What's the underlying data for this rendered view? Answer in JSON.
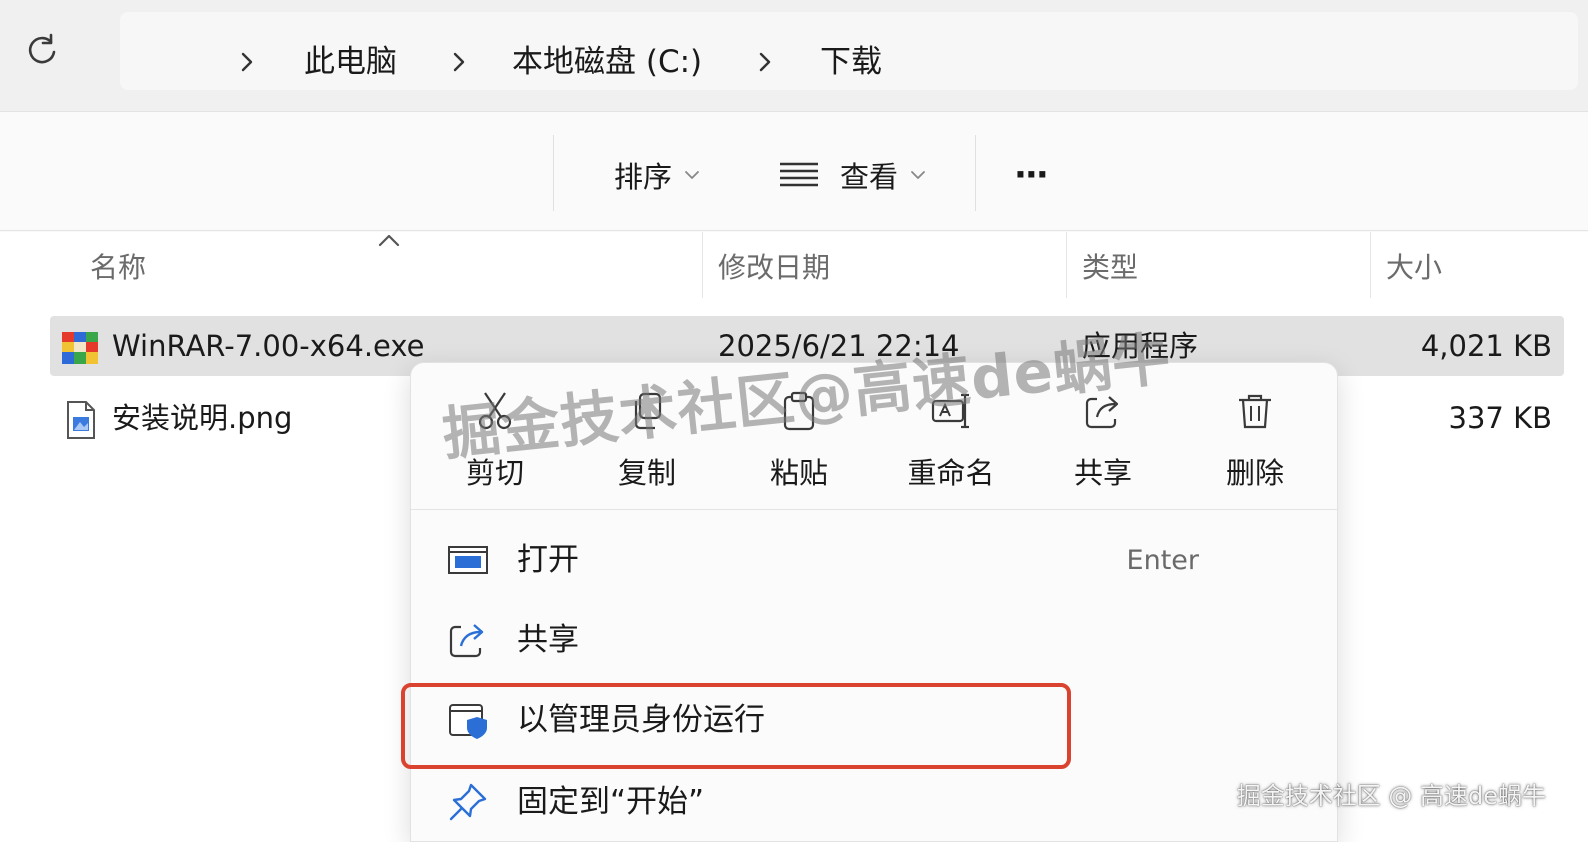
{
  "breadcrumb": {
    "items": [
      "此电脑",
      "本地磁盘 (C:)",
      "下载"
    ]
  },
  "toolbar": {
    "sort_label": "排序",
    "view_label": "查看",
    "more_label": "···"
  },
  "columns": {
    "name": "名称",
    "modified": "修改日期",
    "type": "类型",
    "size": "大小"
  },
  "files": [
    {
      "name": "WinRAR-7.00-x64.exe",
      "modified": "2025/6/21 22:14",
      "type": "应用程序",
      "size": "4,021 KB",
      "icon": "winrar-icon",
      "selected": true
    },
    {
      "name": "安装说明.png",
      "modified": "",
      "type": "",
      "size": "337 KB",
      "icon": "png-file-icon",
      "selected": false
    }
  ],
  "context_menu": {
    "quick_actions": [
      {
        "label": "剪切",
        "icon": "scissors-icon"
      },
      {
        "label": "复制",
        "icon": "copy-icon"
      },
      {
        "label": "粘贴",
        "icon": "paste-icon"
      },
      {
        "label": "重命名",
        "icon": "rename-icon"
      },
      {
        "label": "共享",
        "icon": "share-icon"
      },
      {
        "label": "删除",
        "icon": "trash-icon"
      }
    ],
    "items": [
      {
        "label": "打开",
        "shortcut": "Enter",
        "icon": "open-window-icon"
      },
      {
        "label": "共享",
        "shortcut": "",
        "icon": "share-icon"
      },
      {
        "label": "以管理员身份运行",
        "shortcut": "",
        "icon": "shield-admin-icon"
      },
      {
        "label": "固定到“开始”",
        "shortcut": "",
        "icon": "pin-icon"
      }
    ]
  },
  "watermarks": {
    "overlay": "掘金技术社区@高速de蜗牛",
    "corner": "掘金技术社区 @ 高速de蜗牛"
  },
  "colors": {
    "highlight_border": "#d9432f",
    "selection_bg": "#e1e1e1",
    "accent_blue": "#2b6fd6"
  }
}
